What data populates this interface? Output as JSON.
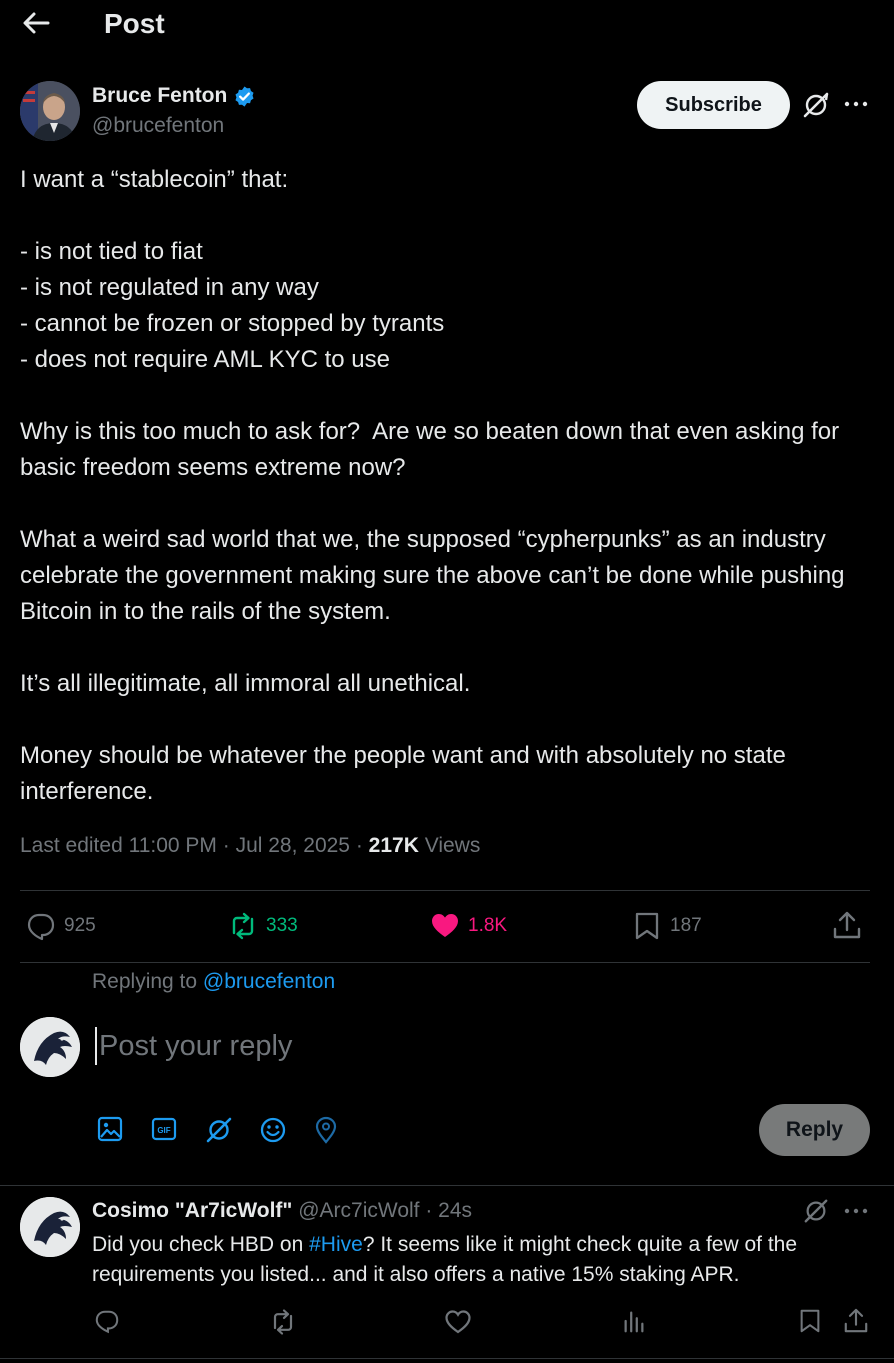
{
  "header": {
    "title": "Post"
  },
  "author": {
    "name": "Bruce Fenton",
    "handle": "@brucefenton",
    "verified": true,
    "subscribe_label": "Subscribe"
  },
  "post": {
    "text": "I want a “stablecoin” that:\n\n- is not tied to fiat\n- is not regulated in any way\n- cannot be frozen or stopped by tyrants\n- does not require AML KYC to use\n\nWhy is this too much to ask for?  Are we so beaten down that even asking for basic freedom seems extreme now?\n\nWhat a weird sad world that we, the supposed “cypherpunks” as an industry celebrate the government making sure the above can’t be done while pushing Bitcoin in to the rails of the system.\n\nIt’s all illegitimate, all immoral all unethical.\n\nMoney should be whatever the people want and with absolutely no state interference.",
    "edited_label": "Last edited 11:00 PM · Jul 28, 2025 · ",
    "views_count": "217K",
    "views_label": " Views"
  },
  "stats": {
    "replies": "925",
    "reposts": "333",
    "likes": "1.8K",
    "bookmarks": "187"
  },
  "colors": {
    "accent": "#1d9bf0",
    "repost": "#00ba7c",
    "like": "#f91880",
    "muted": "#71767b"
  },
  "compose": {
    "replying_prefix": "Replying to ",
    "replying_handle": "@brucefenton",
    "placeholder": "Post your reply",
    "reply_label": "Reply"
  },
  "comment": {
    "name": "Cosimo \"Ar7icWolf\"",
    "handle_time": " @Arc7icWolf · 24s",
    "text_before": "Did you check HBD on ",
    "hashtag": "#Hive",
    "text_after": "? It seems like it might check quite a few of the requirements you listed... and it also offers a native 15% staking APR."
  }
}
